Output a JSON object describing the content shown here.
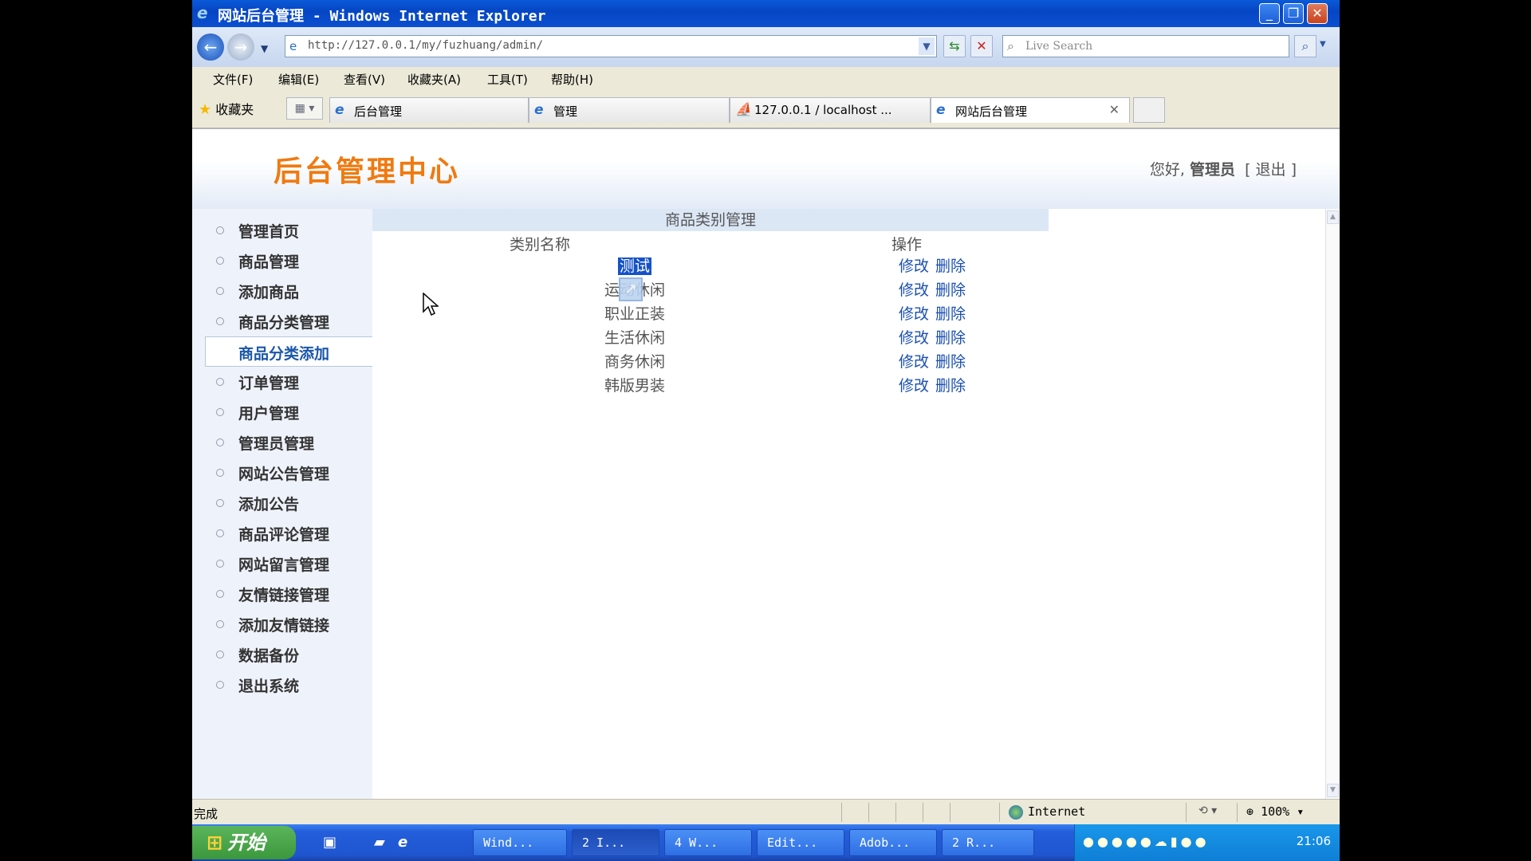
{
  "window": {
    "title": "网站后台管理 - Windows Internet Explorer",
    "url": "http://127.0.0.1/my/fuzhuang/admin/",
    "search_placeholder": "Live Search",
    "menu": [
      "文件(F)",
      "编辑(E)",
      "查看(V)",
      "收藏夹(A)",
      "工具(T)",
      "帮助(H)"
    ],
    "favorites_label": "收藏夹",
    "tabs": [
      {
        "label": "后台管理"
      },
      {
        "label": "管理"
      },
      {
        "label": "127.0.0.1 / localhost ..."
      },
      {
        "label": "网站后台管理"
      }
    ]
  },
  "page": {
    "logo": "后台管理中心",
    "greeting": "您好,",
    "user": "管理员",
    "logout": "[ 退出 ]",
    "sidebar": [
      "管理首页",
      "商品管理",
      "添加商品",
      "商品分类管理",
      "商品分类添加",
      "订单管理",
      "用户管理",
      "管理员管理",
      "网站公告管理",
      "添加公告",
      "商品评论管理",
      "网站留言管理",
      "友情链接管理",
      "添加友情链接",
      "数据备份",
      "退出系统"
    ],
    "sidebar_active": "商品分类添加",
    "section_title": "商品类别管理",
    "col_name": "类别名称",
    "col_ops": "操作",
    "categories": [
      "测试",
      "运动休闲",
      "职业正装",
      "生活休闲",
      "商务休闲",
      "韩版男装"
    ],
    "edit_label": "修改",
    "delete_label": "删除"
  },
  "status": {
    "text": "完成",
    "zone": "Internet",
    "zoom": "100%"
  },
  "taskbar": {
    "start": "开始",
    "buttons": [
      "Wind...",
      "2 I...",
      "4 W...",
      "Edit...",
      "Adob...",
      "2 R..."
    ],
    "clock": "21:06"
  }
}
